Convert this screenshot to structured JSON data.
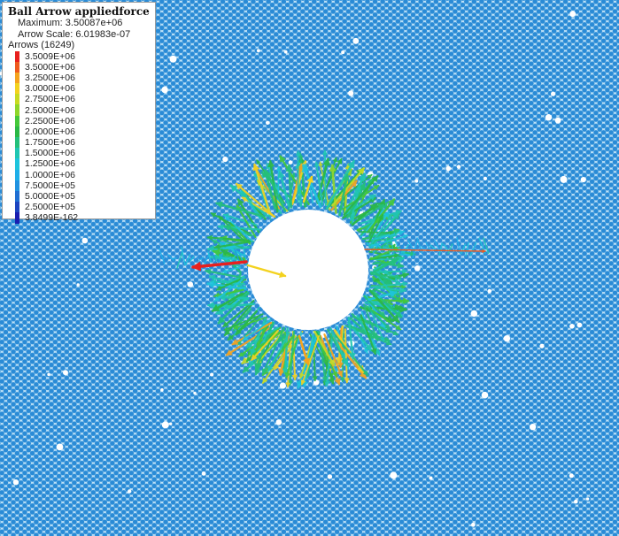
{
  "legend": {
    "title": "Ball Arrow appliedforce",
    "maximum": "Maximum: 3.50087e+06",
    "arrow_scale": "Arrow Scale: 6.01983e-07",
    "arrows_count": "Arrows (16249)",
    "scale": [
      {
        "label": "3.5009E+06",
        "color": "#e8201e"
      },
      {
        "label": "3.5000E+06",
        "color": "#ef5a1e"
      },
      {
        "label": "3.2500E+06",
        "color": "#f5a31e"
      },
      {
        "label": "3.0000E+06",
        "color": "#f3d21f"
      },
      {
        "label": "2.7500E+06",
        "color": "#c8da22"
      },
      {
        "label": "2.5000E+06",
        "color": "#8fd62a"
      },
      {
        "label": "2.2500E+06",
        "color": "#45c83a"
      },
      {
        "label": "2.0000E+06",
        "color": "#2ab845"
      },
      {
        "label": "1.7500E+06",
        "color": "#24c07a"
      },
      {
        "label": "1.5000E+06",
        "color": "#20c6b2"
      },
      {
        "label": "1.2500E+06",
        "color": "#1ec4dc"
      },
      {
        "label": "1.0000E+06",
        "color": "#1eaee8"
      },
      {
        "label": "7.5000E+05",
        "color": "#2092e0"
      },
      {
        "label": "5.0000E+05",
        "color": "#1f6fd2"
      },
      {
        "label": "2.5000E+05",
        "color": "#1c45c0"
      },
      {
        "label": "3.8499E-162",
        "color": "#1a1eb0"
      }
    ]
  },
  "colors": {
    "ball": "#2a8bd6",
    "ball_edge": "#bfe2f7",
    "cavity": "#ffffff"
  }
}
